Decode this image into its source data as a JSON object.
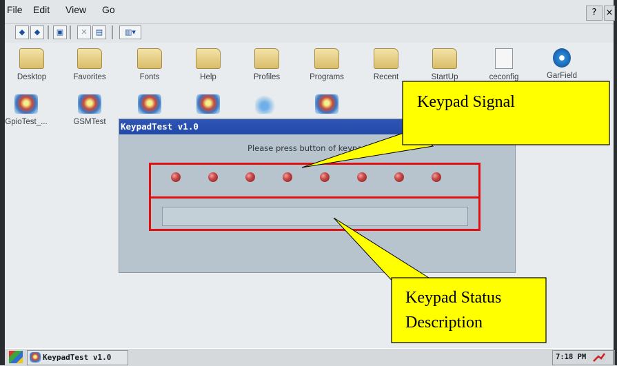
{
  "menu": {
    "file": "File",
    "edit": "Edit",
    "view": "View",
    "go": "Go",
    "help_label": "?",
    "close_label": "×"
  },
  "toolbar": {
    "buttons": [
      "back-icon",
      "forward-icon",
      "up-folder-icon",
      "delete-icon",
      "properties-icon",
      "view-menu-icon"
    ]
  },
  "desktop_icons": [
    {
      "label": "Desktop",
      "icon": "folder-icon"
    },
    {
      "label": "Favorites",
      "icon": "folder-icon"
    },
    {
      "label": "Fonts",
      "icon": "folder-icon"
    },
    {
      "label": "Help",
      "icon": "folder-icon"
    },
    {
      "label": "Profiles",
      "icon": "folder-icon"
    },
    {
      "label": "Programs",
      "icon": "folder-icon"
    },
    {
      "label": "Recent",
      "icon": "folder-icon"
    },
    {
      "label": "StartUp",
      "icon": "folder-icon"
    },
    {
      "label": "ceconfig",
      "icon": "config-file-icon"
    },
    {
      "label": "GarField",
      "icon": "media-app-icon"
    },
    {
      "label": "GpioTest_...",
      "icon": "app-cube-icon"
    },
    {
      "label": "GSMTest",
      "icon": "app-cube-icon"
    }
  ],
  "dialog": {
    "title": "KeypadTest v1.0",
    "prompt": "Please press button of keypad.",
    "led_count": 8,
    "status_text": ""
  },
  "callouts": {
    "signal": "Keypad Signal",
    "status_line1": "Keypad Status",
    "status_line2": "Description"
  },
  "taskbar": {
    "task_label": "KeypadTest v1.0",
    "clock": "7:18 PM"
  },
  "colors": {
    "highlight": "#e01010",
    "callout_fill": "#ffff00",
    "led": "#c64848",
    "titlebar": "#2349a7"
  }
}
